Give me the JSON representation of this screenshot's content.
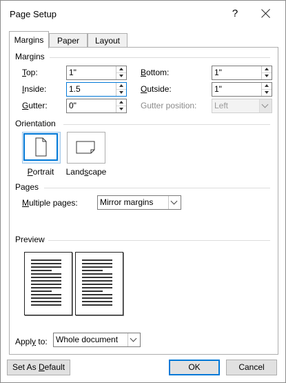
{
  "window": {
    "title": "Page Setup",
    "help_label": "?"
  },
  "tabs": [
    {
      "label": "Margins",
      "active": true
    },
    {
      "label": "Paper",
      "active": false
    },
    {
      "label": "Layout",
      "active": false
    }
  ],
  "margins": {
    "section_label": "Margins",
    "top": {
      "label_first": "T",
      "label_rest": "op:",
      "value": "1\""
    },
    "bottom": {
      "label_first": "B",
      "label_rest": "ottom:",
      "value": "1\""
    },
    "inside": {
      "label_first": "I",
      "label_rest": "nside:",
      "value": "1.5"
    },
    "outside": {
      "label_first": "O",
      "label_rest": "utside:",
      "value": "1\""
    },
    "gutter": {
      "label_first": "G",
      "label_rest": "utter:",
      "value": "0\""
    },
    "gutter_position": {
      "label": "Gutter position:",
      "value": "Left"
    }
  },
  "orientation": {
    "section_label": "Orientation",
    "portrait": {
      "label_first": "P",
      "label_rest": "ortrait",
      "selected": true
    },
    "landscape": {
      "label_pre": "Land",
      "label_ul": "s",
      "label_post": "cape",
      "selected": false
    }
  },
  "pages": {
    "section_label": "Pages",
    "multiple_pages": {
      "label_first": "M",
      "label_rest": "ultiple pages:",
      "value": "Mirror margins"
    }
  },
  "preview": {
    "section_label": "Preview"
  },
  "apply_to": {
    "label_pre": "Appl",
    "label_ul": "y",
    "label_post": " to:",
    "value": "Whole document"
  },
  "buttons": {
    "set_default_pre": "Set As ",
    "set_default_ul": "D",
    "set_default_post": "efault",
    "ok": "OK",
    "cancel": "Cancel"
  },
  "colors": {
    "focus_accent": "#0078d7",
    "button_face": "#e1e1e1"
  }
}
